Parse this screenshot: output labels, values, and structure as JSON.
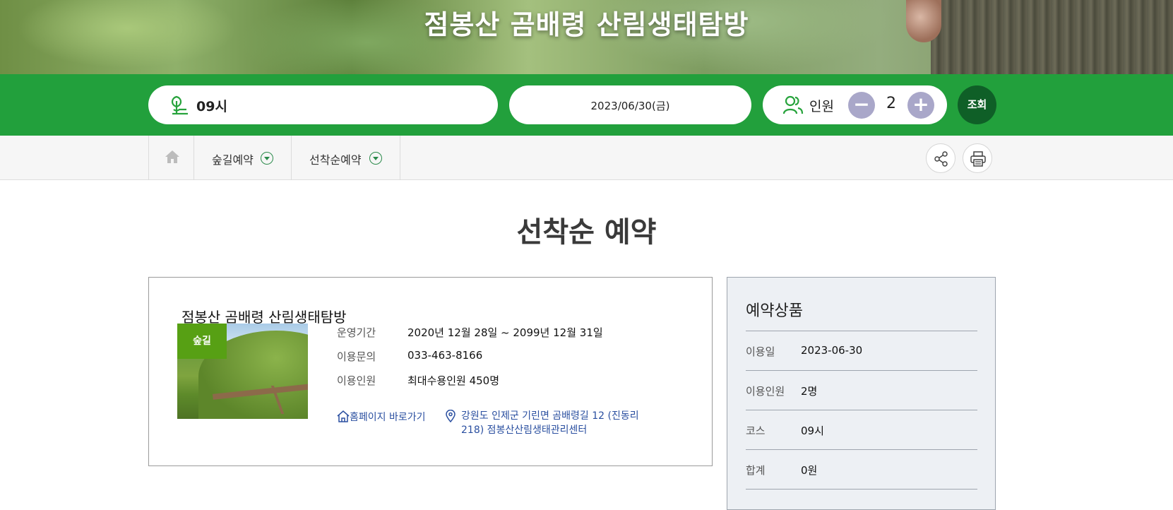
{
  "hero": {
    "title": "점봉산 곰배령 산림생태탐방"
  },
  "search": {
    "course_value": "09시",
    "date_value": "2023/06/30(금)",
    "people_label": "인원",
    "people_count": "2",
    "minus_symbol": "−",
    "plus_symbol": "+",
    "search_button": "조회"
  },
  "nav": {
    "items": [
      {
        "label": "숲길예약"
      },
      {
        "label": "선착순예약"
      }
    ]
  },
  "page_title": "선착순 예약",
  "product": {
    "title": "점봉산 곰배령 산림생태탐방",
    "tag": "숲길",
    "rows": [
      {
        "key": "운영기간",
        "value": "2020년 12월 28일 ~ 2099년 12월 31일"
      },
      {
        "key": "이용문의",
        "value": "033-463-8166"
      },
      {
        "key": "이용인원",
        "value": "최대수용인원 450명"
      }
    ],
    "homepage_link": "홈페이지 바로가기",
    "address_line1": "강원도 인제군 기린면 곰배령길 12 (진동리",
    "address_line2": "218) 점봉산산림생태관리센터"
  },
  "summary": {
    "title": "예약상품",
    "rows": [
      {
        "key": "이용일",
        "value": "2023-06-30"
      },
      {
        "key": "이용인원",
        "value": "2명"
      },
      {
        "key": "코스",
        "value": "09시"
      },
      {
        "key": "합계",
        "value": "0원"
      }
    ]
  },
  "colors": {
    "search_bar": "#22a03c",
    "search_button": "#0f5f27",
    "tag": "#57a014",
    "link": "#2a4fa0",
    "stepper": "#a9a7c9"
  }
}
